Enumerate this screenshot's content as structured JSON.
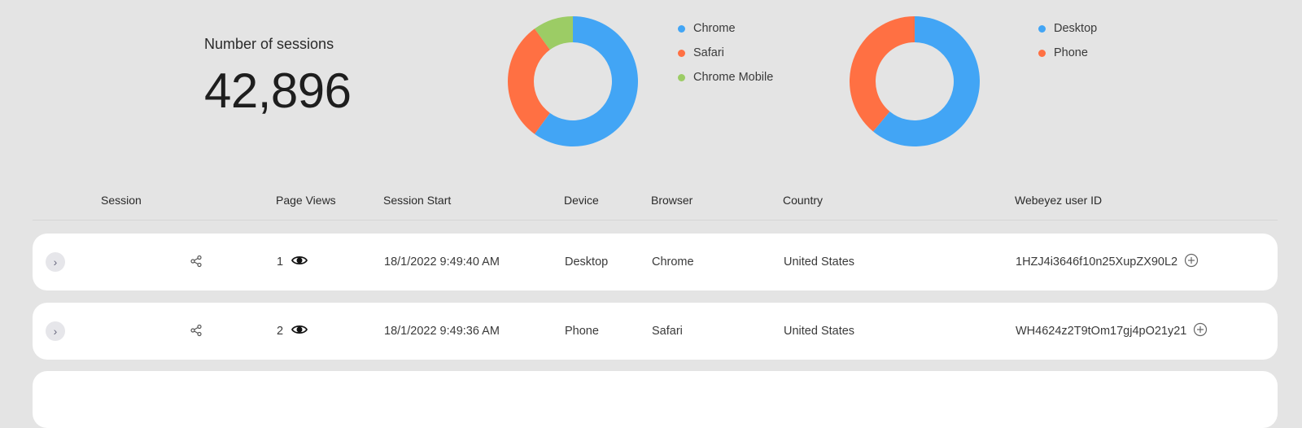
{
  "kpi": {
    "title": "Number of sessions",
    "value": "42,896"
  },
  "colors": {
    "blue": "#42a5f5",
    "orange": "#ff7043",
    "green": "#9ccc65"
  },
  "chart_data": [
    {
      "type": "pie",
      "variant": "donut",
      "categories": [
        "Chrome",
        "Safari",
        "Chrome Mobile"
      ],
      "values": [
        60,
        30,
        10
      ],
      "colors": [
        "#42a5f5",
        "#ff7043",
        "#9ccc65"
      ],
      "legend": "right"
    },
    {
      "type": "pie",
      "variant": "donut",
      "categories": [
        "Desktop",
        "Phone"
      ],
      "values": [
        61,
        39
      ],
      "colors": [
        "#42a5f5",
        "#ff7043"
      ],
      "legend": "right"
    }
  ],
  "table": {
    "headers": {
      "session": "Session",
      "page_views": "Page Views",
      "session_start": "Session Start",
      "device": "Device",
      "browser": "Browser",
      "country": "Country",
      "user_id": "Webeyez user ID"
    },
    "rows": [
      {
        "page_views": "1",
        "session_start": "18/1/2022 9:49:40 AM",
        "device": "Desktop",
        "browser": "Chrome",
        "country": "United States",
        "user_id": "1HZJ4i3646f10n25XupZX90L2"
      },
      {
        "page_views": "2",
        "session_start": "18/1/2022 9:49:36 AM",
        "device": "Phone",
        "browser": "Safari",
        "country": "United States",
        "user_id": "WH4624z2T9tOm17gj4pO21y21"
      }
    ]
  }
}
